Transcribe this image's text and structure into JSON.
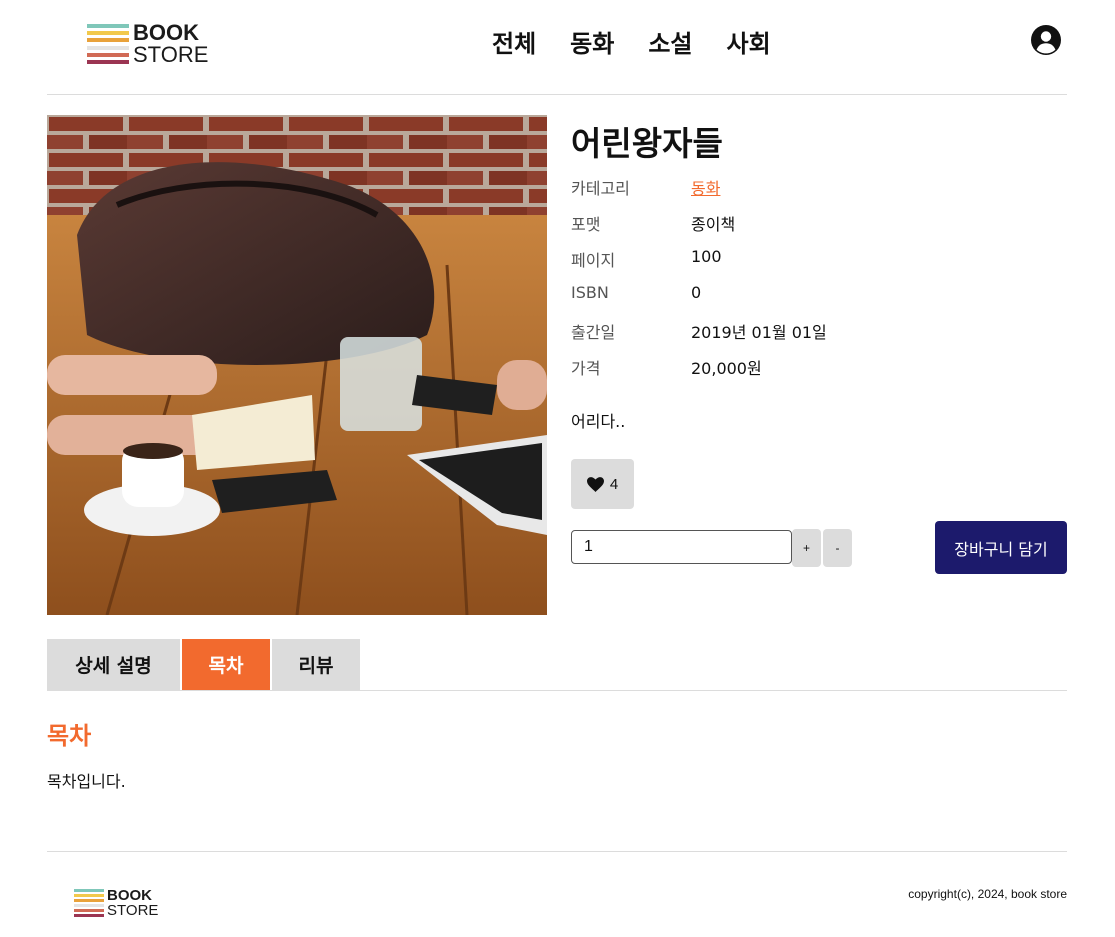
{
  "header": {
    "logo": {
      "line1": "BOOK",
      "line2": "STORE",
      "colors": [
        "#7fc7b9",
        "#f2c94c",
        "#e9a23b",
        "#e4e4e4",
        "#d16a55",
        "#9b3552"
      ]
    },
    "nav": [
      "전체",
      "동화",
      "소설",
      "사회"
    ]
  },
  "book": {
    "title": "어린왕자들",
    "details": [
      {
        "label": "카테고리",
        "value": "동화",
        "link": true
      },
      {
        "label": "포맷",
        "value": "종이책"
      },
      {
        "label": "페이지",
        "value": "100"
      },
      {
        "label": "ISBN",
        "value": "0"
      },
      {
        "label": "출간일",
        "value": "2019년 01월 01일"
      },
      {
        "label": "가격",
        "value": "20,000원"
      }
    ],
    "summary": "어리다..",
    "likes": "4",
    "quantity": "1",
    "plus_label": "+",
    "minus_label": "-",
    "cart_label": "장바구니 담기"
  },
  "tabs": [
    {
      "label": "상세 설명",
      "active": false
    },
    {
      "label": "목차",
      "active": true
    },
    {
      "label": "리뷰",
      "active": false
    }
  ],
  "content": {
    "title": "목차",
    "body": "목차입니다."
  },
  "footer": {
    "copyright": "copyright(c), 2024, book store"
  },
  "colors": {
    "accent": "#f26a2e",
    "primary_button": "#1c1a6c",
    "tab_bg": "#dcdcdc"
  }
}
